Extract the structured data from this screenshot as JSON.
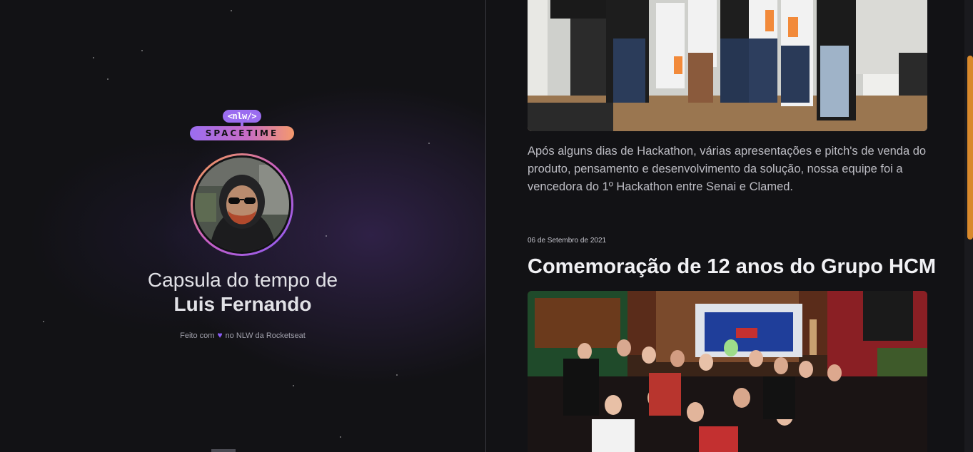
{
  "logo": {
    "tag": "<nlw/>",
    "name": "SPACETIME"
  },
  "profile": {
    "avatar_icon": "user-avatar-photo",
    "heading_prefix": "Capsula do tempo de",
    "name": "Luis Fernando"
  },
  "footer": {
    "made_with": "Feito com",
    "heart_icon": "heart-icon",
    "rest": "no NLW da Rocketseat"
  },
  "memories": [
    {
      "image": "team-hackathon-photo",
      "text": "Após alguns dias de Hackathon, várias apresentações e pitch's de venda do produto, pensamento e desenvolvimento da solução, nossa equipe foi a vencedora do 1º Hackathon entre Senai e Clamed."
    },
    {
      "date": "06 de Setembro de 2021",
      "title": "Comemoração de 12 anos do Grupo HCM",
      "image": "hcm-anniversary-group-photo"
    }
  ],
  "colors": {
    "background": "#121215",
    "accent_purple": "#8b5cf6",
    "accent_orange": "#f5996c",
    "scrollbar_thumb": "#d9892b"
  }
}
